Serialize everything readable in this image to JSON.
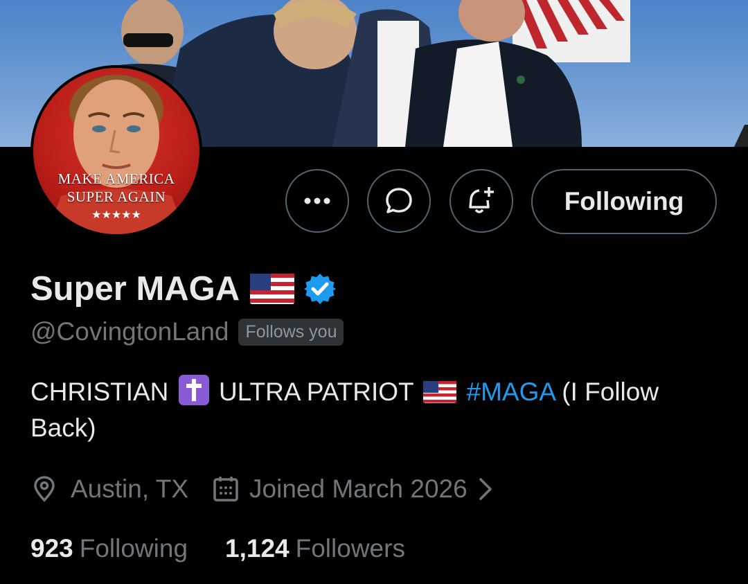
{
  "profile": {
    "display_name": "Super MAGA",
    "handle": "@CovingtonLand",
    "follows_you_label": "Follows you",
    "verified": true,
    "flag_emoji": "us-flag-icon"
  },
  "avatar": {
    "line1": "MAKE AMERICA",
    "line2": "SUPER AGAIN",
    "stars": "★★★★★"
  },
  "actions": {
    "more_icon": "more-icon",
    "message_icon": "message-icon",
    "notify_icon": "bell-plus-icon",
    "following_label": "Following"
  },
  "bio": {
    "part1": "CHRISTIAN",
    "part2": "ULTRA PATRIOT",
    "hashtag": "#MAGA",
    "part3": "(I Follow Back)"
  },
  "meta": {
    "location": "Austin, TX",
    "joined": "Joined March 2026"
  },
  "stats": {
    "following_count": "923",
    "following_label": "Following",
    "followers_count": "1,124",
    "followers_label": "Followers"
  },
  "colors": {
    "background": "#000000",
    "text_primary": "#e7e9ea",
    "text_secondary": "#71767b",
    "accent": "#1d9bf0",
    "border": "#536471"
  }
}
